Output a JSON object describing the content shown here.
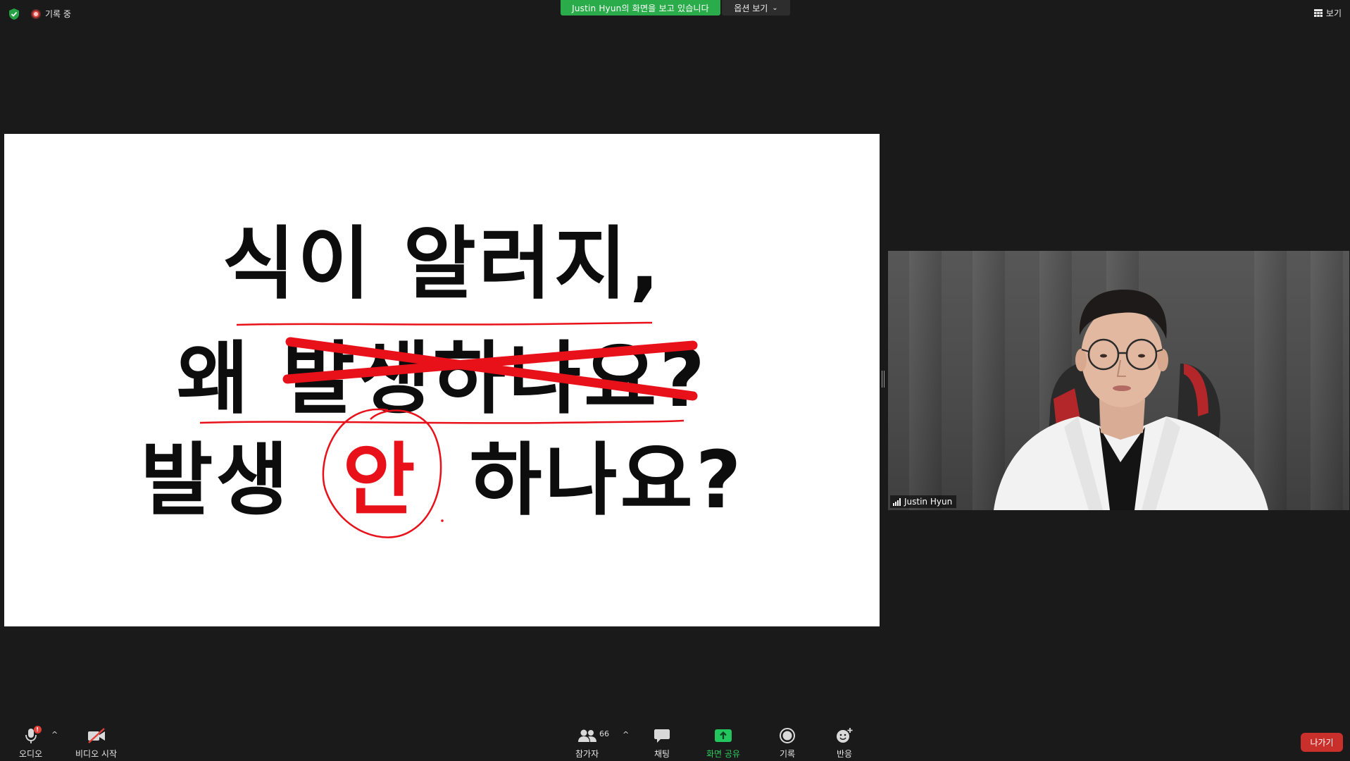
{
  "top": {
    "recording_label": "기록 중",
    "share_banner": "Justin Hyun의 화면을 보고 있습니다",
    "options_label": "옵션 보기",
    "view_label": "보기"
  },
  "slide": {
    "line1": "식이 알러지,",
    "line2": "왜 발생하나요?",
    "line3_a": "발생",
    "line3_b": "안",
    "line3_c": "하나요?"
  },
  "video": {
    "participant_name": "Justin Hyun"
  },
  "toolbar": {
    "audio_label": "오디오",
    "audio_badge": "!",
    "video_label": "비디오 시작",
    "participants_label": "참가자",
    "participants_count": "66",
    "chat_label": "채팅",
    "share_label": "화면 공유",
    "record_label": "기록",
    "reactions_label": "반응",
    "leave_label": "나가기"
  },
  "colors": {
    "background": "#1a1a1a",
    "share_green": "#2aac4a",
    "leave_red": "#c9302c",
    "annotation_red": "#e8111a"
  },
  "icons": {
    "security": "shield-check-icon",
    "recording": "record-dot-icon",
    "view": "grid-icon",
    "audio": "microphone-icon",
    "video": "video-camera-off-icon",
    "participants": "people-icon",
    "chat": "chat-bubble-icon",
    "share": "share-screen-up-arrow-icon",
    "record": "record-circle-icon",
    "reactions": "smiley-plus-icon"
  }
}
